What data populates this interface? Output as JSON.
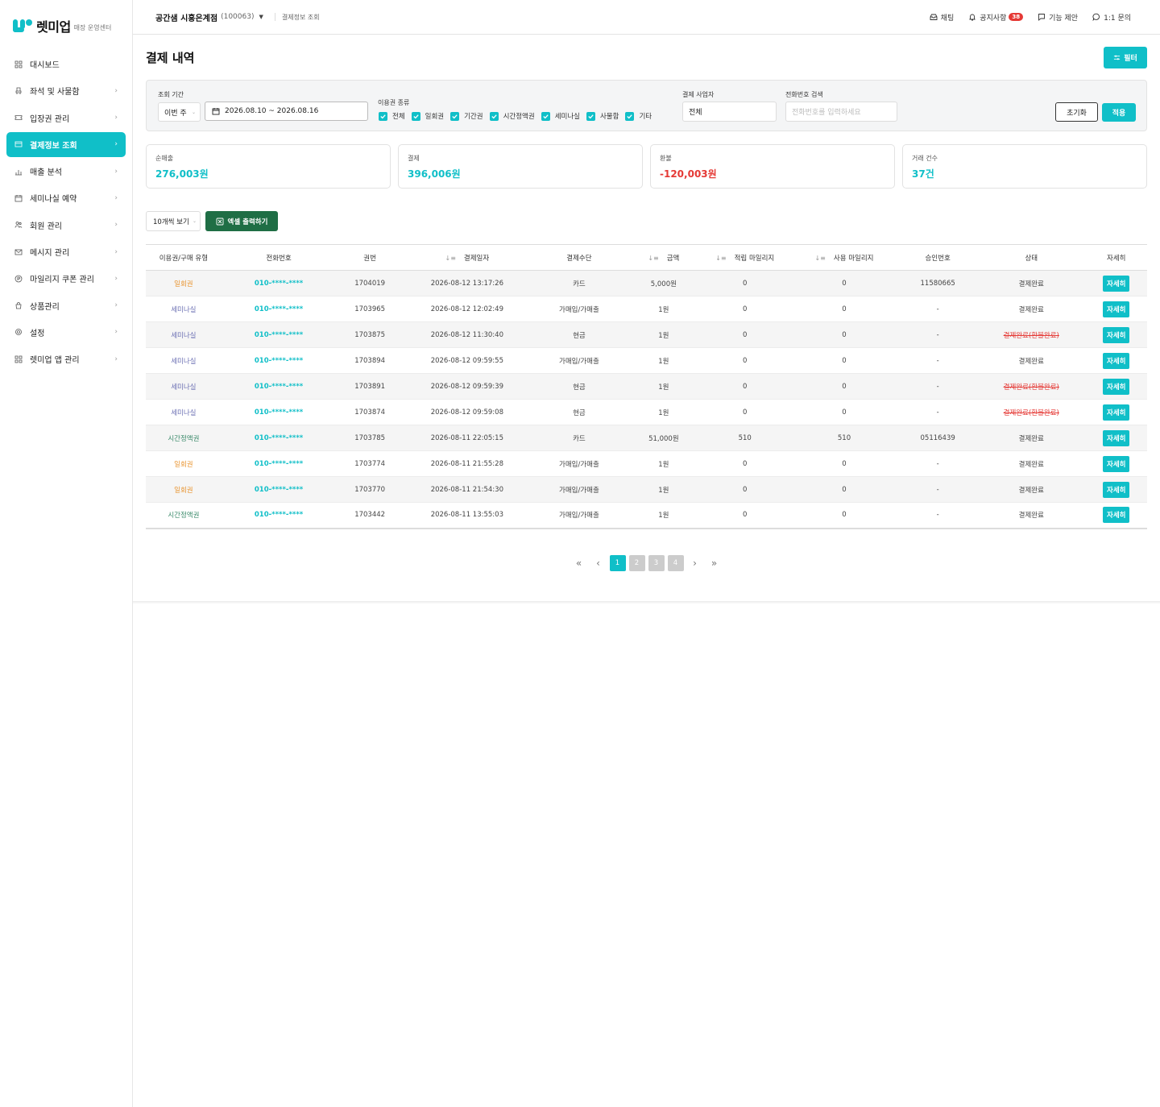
{
  "brand": {
    "name": "렛미업",
    "sub": "매장 운영센터"
  },
  "sidebar": {
    "items": [
      {
        "label": "대시보드",
        "icon": "grid-icon",
        "chev": ""
      },
      {
        "label": "좌석 및 사물함",
        "icon": "seat-icon",
        "chev": "›"
      },
      {
        "label": "입장권 관리",
        "icon": "ticket-icon",
        "chev": "›"
      },
      {
        "label": "결제정보 조회",
        "icon": "card-icon",
        "chev": "›"
      },
      {
        "label": "매출 분석",
        "icon": "chart-icon",
        "chev": "›"
      },
      {
        "label": "세미나실 예약",
        "icon": "calendar-icon",
        "chev": "›"
      },
      {
        "label": "회원 관리",
        "icon": "users-icon",
        "chev": "›"
      },
      {
        "label": "메시지 관리",
        "icon": "mail-icon",
        "chev": "›"
      },
      {
        "label": "마일리지 쿠폰 관리",
        "icon": "coin-icon",
        "chev": "›"
      },
      {
        "label": "상품관리",
        "icon": "bag-icon",
        "chev": "›"
      },
      {
        "label": "설정",
        "icon": "gear-icon",
        "chev": "›"
      },
      {
        "label": "렛미업 앱 관리",
        "icon": "apps-icon",
        "chev": "›"
      }
    ]
  },
  "topbar": {
    "store": "공간샘 시흥은계점",
    "store_code": "(100063)",
    "breadcrumb": "결제정보 조회",
    "chat": "채팅",
    "notice": "공지사항",
    "notice_count": "38",
    "suggest": "기능 제안",
    "inquiry": "1:1 문의"
  },
  "page": {
    "title": "결제 내역",
    "filter_btn": "필터"
  },
  "filters": {
    "period_label": "조회 기간",
    "period_select": "이번 주",
    "date_range": "2026.08.10 ~ 2026.08.16",
    "types_label": "이용권 종류",
    "types": [
      "전체",
      "일회권",
      "기간권",
      "시간정액권",
      "세미나실",
      "사물함",
      "기타"
    ],
    "biz_label": "결제 사업자",
    "biz_value": "전체",
    "phone_label": "전화번호 검색",
    "phone_placeholder": "전화번호를 입력하세요",
    "reset": "초기화",
    "apply": "적용"
  },
  "stats": [
    {
      "label": "순매출",
      "value": "276,003원",
      "neg": false
    },
    {
      "label": "결제",
      "value": "396,006원",
      "neg": false
    },
    {
      "label": "환불",
      "value": "-120,003원",
      "neg": true
    },
    {
      "label": "거래 건수",
      "value": "37건",
      "neg": false
    }
  ],
  "toolbar": {
    "page_size": "10개씩 보기",
    "excel": "엑셀 출력하기"
  },
  "table": {
    "headers": [
      "이용권/구매 유형",
      "전화번호",
      "권번",
      "결제일자",
      "결제수단",
      "금액",
      "적립 마일리지",
      "사용 마일리지",
      "승인번호",
      "상태",
      "자세히"
    ],
    "sortable": [
      false,
      false,
      false,
      true,
      false,
      true,
      true,
      true,
      false,
      false,
      false
    ],
    "sort_glyph": "↓≡",
    "detail_label": "자세히",
    "rows": [
      {
        "type": "일회권",
        "tc": "t-orange",
        "phone": "010-****-****",
        "no": "1704019",
        "date": "2026-08-12 13:17:26",
        "method": "카드",
        "amount": "5,000원",
        "earn": "0",
        "use": "0",
        "approval": "11580665",
        "status": "결제완료",
        "refund": false
      },
      {
        "type": "세미나실",
        "tc": "t-purple",
        "phone": "010-****-****",
        "no": "1703965",
        "date": "2026-08-12 12:02:49",
        "method": "가매입/가매출",
        "amount": "1원",
        "earn": "0",
        "use": "0",
        "approval": "-",
        "status": "결제완료",
        "refund": false
      },
      {
        "type": "세미나실",
        "tc": "t-purple",
        "phone": "010-****-****",
        "no": "1703875",
        "date": "2026-08-12 11:30:40",
        "method": "현금",
        "amount": "1원",
        "earn": "0",
        "use": "0",
        "approval": "-",
        "status": "결제완료(환불완료)",
        "refund": true
      },
      {
        "type": "세미나실",
        "tc": "t-purple",
        "phone": "010-****-****",
        "no": "1703894",
        "date": "2026-08-12 09:59:55",
        "method": "가매입/가매출",
        "amount": "1원",
        "earn": "0",
        "use": "0",
        "approval": "-",
        "status": "결제완료",
        "refund": false
      },
      {
        "type": "세미나실",
        "tc": "t-purple",
        "phone": "010-****-****",
        "no": "1703891",
        "date": "2026-08-12 09:59:39",
        "method": "현금",
        "amount": "1원",
        "earn": "0",
        "use": "0",
        "approval": "-",
        "status": "결제완료(환불완료)",
        "refund": true
      },
      {
        "type": "세미나실",
        "tc": "t-purple",
        "phone": "010-****-****",
        "no": "1703874",
        "date": "2026-08-12 09:59:08",
        "method": "현금",
        "amount": "1원",
        "earn": "0",
        "use": "0",
        "approval": "-",
        "status": "결제완료(환불완료)",
        "refund": true
      },
      {
        "type": "시간정액권",
        "tc": "t-green",
        "phone": "010-****-****",
        "no": "1703785",
        "date": "2026-08-11 22:05:15",
        "method": "카드",
        "amount": "51,000원",
        "earn": "510",
        "use": "510",
        "approval": "05116439",
        "status": "결제완료",
        "refund": false
      },
      {
        "type": "일회권",
        "tc": "t-orange",
        "phone": "010-****-****",
        "no": "1703774",
        "date": "2026-08-11 21:55:28",
        "method": "가매입/가매출",
        "amount": "1원",
        "earn": "0",
        "use": "0",
        "approval": "-",
        "status": "결제완료",
        "refund": false
      },
      {
        "type": "일회권",
        "tc": "t-orange",
        "phone": "010-****-****",
        "no": "1703770",
        "date": "2026-08-11 21:54:30",
        "method": "가매입/가매출",
        "amount": "1원",
        "earn": "0",
        "use": "0",
        "approval": "-",
        "status": "결제완료",
        "refund": false
      },
      {
        "type": "시간정액권",
        "tc": "t-green",
        "phone": "010-****-****",
        "no": "1703442",
        "date": "2026-08-11 13:55:03",
        "method": "가매입/가매출",
        "amount": "1원",
        "earn": "0",
        "use": "0",
        "approval": "-",
        "status": "결제완료",
        "refund": false
      }
    ]
  },
  "pagination": {
    "pages": [
      "1",
      "2",
      "3",
      "4"
    ],
    "current": "1",
    "first": "«",
    "prev": "‹",
    "next": "›",
    "last": "»"
  },
  "colors": {
    "accent": "#10bfc8",
    "excel": "#1f6e45",
    "danger": "#e53935"
  }
}
